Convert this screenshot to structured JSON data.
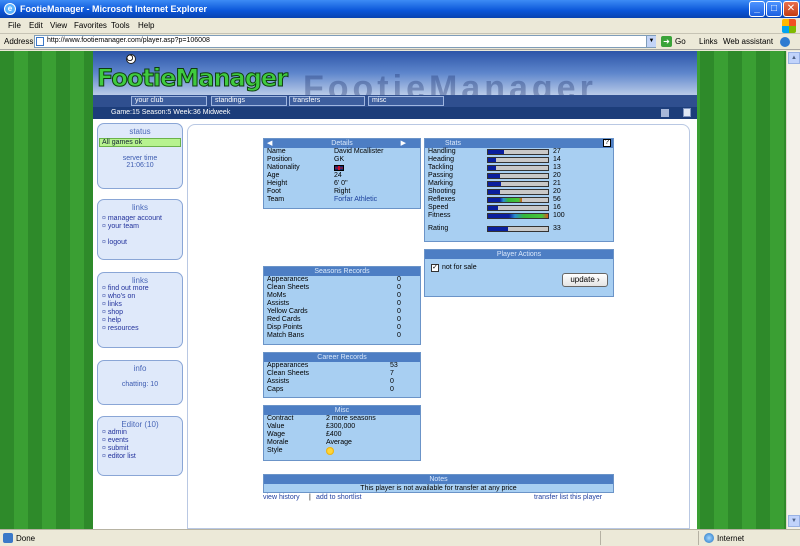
{
  "window": {
    "title": "FootieManager - Microsoft Internet Explorer"
  },
  "menu": [
    "File",
    "Edit",
    "View",
    "Favorites",
    "Tools",
    "Help"
  ],
  "address": {
    "label": "Address",
    "url": "http://www.footiemanager.com/player.asp?p=106008",
    "go": "Go",
    "links": "Links",
    "assistant": "Web assistant"
  },
  "site": {
    "logo": "FootieManager",
    "watermark": "FootieManager",
    "nav": [
      "your club",
      "standings",
      "transfers",
      "misc"
    ],
    "info": "Game:15  Season:5  Week:36 Midweek"
  },
  "sidebar": {
    "status": {
      "title": "status",
      "ok": "All games ok",
      "server_label": "server time",
      "server_time": "21:06:10"
    },
    "links1": {
      "title": "links",
      "items": [
        "manager account",
        "your team",
        "logout"
      ]
    },
    "links2": {
      "title": "links",
      "items": [
        "find out more",
        "who's on",
        "links",
        "shop",
        "help",
        "resources"
      ]
    },
    "info": {
      "title": "info",
      "chatting": "chatting: 10"
    },
    "editor": {
      "title": "Editor (10)",
      "items": [
        "admin",
        "events",
        "submit",
        "editor list"
      ]
    }
  },
  "details": {
    "title": "Details",
    "prev": "◀",
    "next": "▶",
    "rows": [
      {
        "k": "Name",
        "v": "David Mcallister"
      },
      {
        "k": "Position",
        "v": "GK"
      },
      {
        "k": "Nationality",
        "v": ""
      },
      {
        "k": "Age",
        "v": "24"
      },
      {
        "k": "Height",
        "v": "6' 0\""
      },
      {
        "k": "Foot",
        "v": "Right"
      },
      {
        "k": "Team",
        "v": "Forfar Athletic"
      }
    ]
  },
  "season": {
    "title": "Seasons Records",
    "rows": [
      {
        "k": "Appearances",
        "v": "0"
      },
      {
        "k": "Clean Sheets",
        "v": "0"
      },
      {
        "k": "MoMs",
        "v": "0"
      },
      {
        "k": "Assists",
        "v": "0"
      },
      {
        "k": "Yellow Cards",
        "v": "0"
      },
      {
        "k": "Red Cards",
        "v": "0"
      },
      {
        "k": "Disp Points",
        "v": "0"
      },
      {
        "k": "Match Bans",
        "v": "0"
      }
    ]
  },
  "career": {
    "title": "Career Records",
    "rows": [
      {
        "k": "Appearances",
        "v": "53"
      },
      {
        "k": "Clean Sheets",
        "v": "7"
      },
      {
        "k": "Assists",
        "v": "0"
      },
      {
        "k": "Caps",
        "v": "0"
      }
    ]
  },
  "misc": {
    "title": "Misc",
    "rows": [
      {
        "k": "Contract",
        "v": "2 more seasons"
      },
      {
        "k": "Value",
        "v": "£300,000"
      },
      {
        "k": "Wage",
        "v": "£400"
      },
      {
        "k": "Morale",
        "v": "Average"
      },
      {
        "k": "Style",
        "v": ""
      }
    ]
  },
  "stats": {
    "title": "Stats",
    "help": "?",
    "rows": [
      {
        "k": "Handling",
        "v": "27",
        "pct": 27
      },
      {
        "k": "Heading",
        "v": "14",
        "pct": 14
      },
      {
        "k": "Tackling",
        "v": "13",
        "pct": 13
      },
      {
        "k": "Passing",
        "v": "20",
        "pct": 20
      },
      {
        "k": "Marking",
        "v": "21",
        "pct": 21
      },
      {
        "k": "Shooting",
        "v": "20",
        "pct": 20
      },
      {
        "k": "Reflexes",
        "v": "56",
        "pct": 56
      },
      {
        "k": "Speed",
        "v": "16",
        "pct": 16
      },
      {
        "k": "Fitness",
        "v": "100",
        "pct": 100
      }
    ],
    "rating": {
      "k": "Rating",
      "v": "33",
      "pct": 33
    }
  },
  "actions": {
    "title": "Player Actions",
    "not_for_sale": "not for sale",
    "update": "update ›"
  },
  "notes": {
    "title": "Notes",
    "text": "This player is not available for transfer at any price"
  },
  "links_bottom": {
    "history": "view history",
    "sep": "|",
    "shortlist": "add to shortlist",
    "transfer": "transfer list this player"
  },
  "statusbar": {
    "done": "Done",
    "zone": "Internet"
  }
}
